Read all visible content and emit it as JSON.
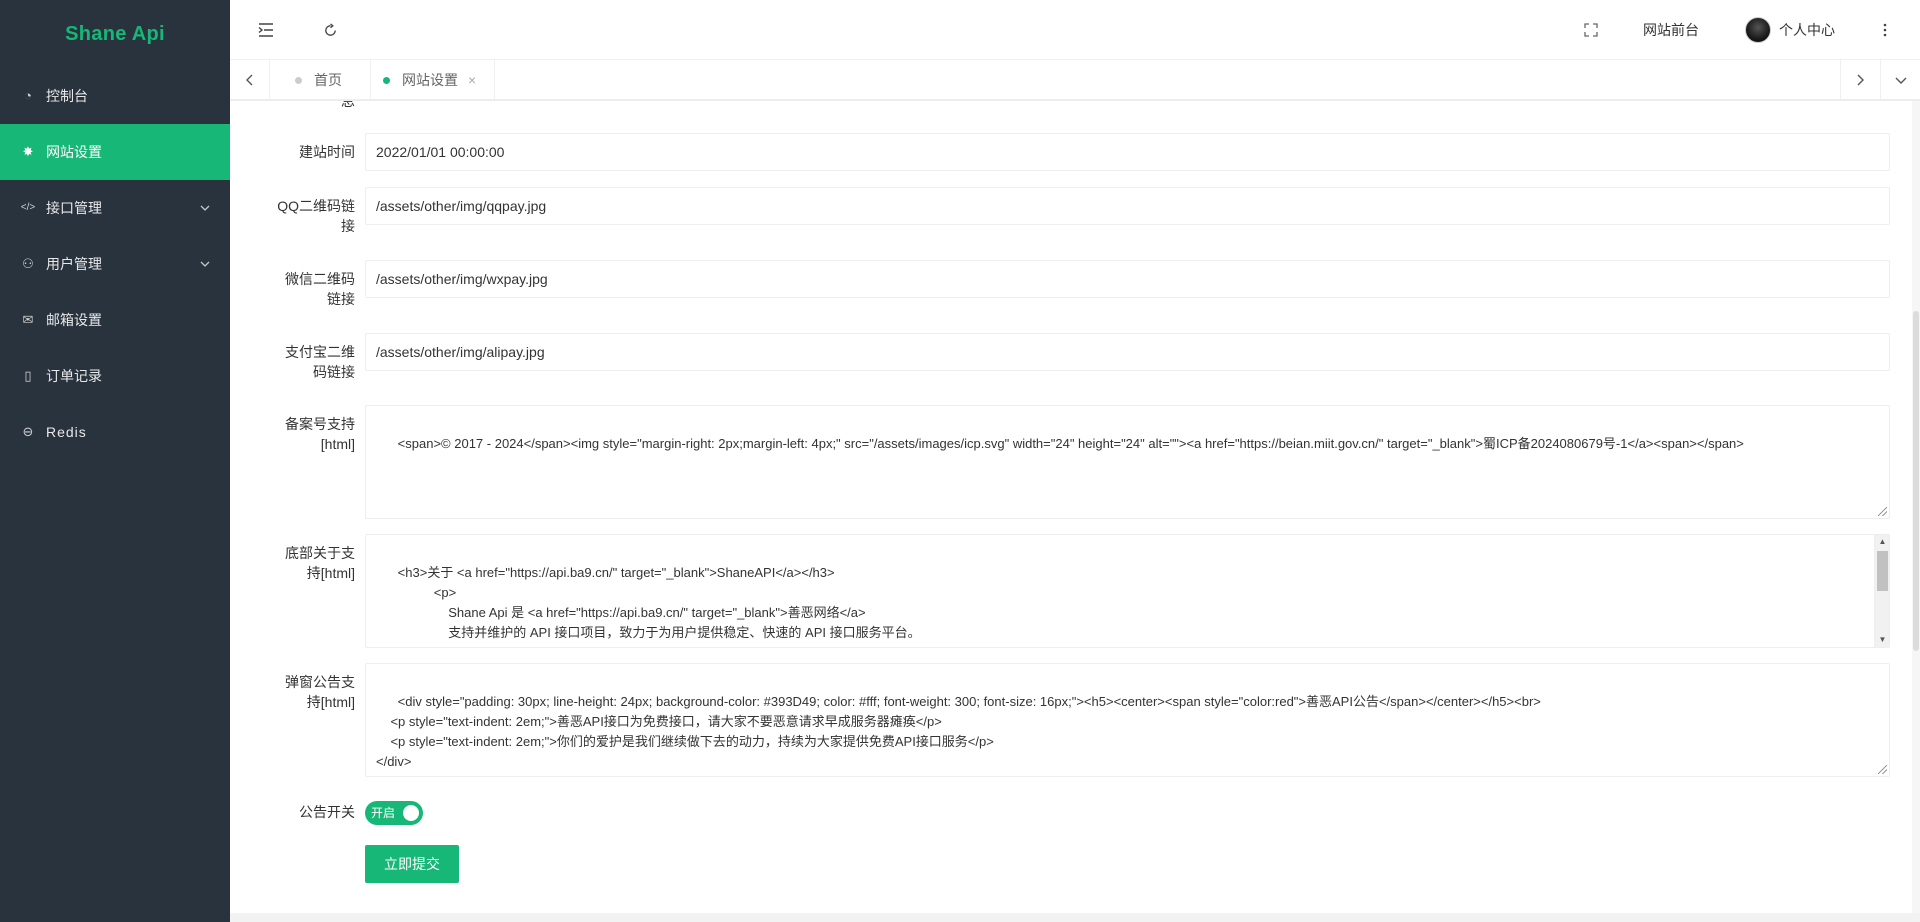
{
  "app": {
    "logo": "Shane Api"
  },
  "sidebar": {
    "items": [
      {
        "label": "控制台",
        "icon": "dashboard-icon",
        "glyph": "◔"
      },
      {
        "label": "网站设置",
        "icon": "gear-icon",
        "glyph": "✸",
        "active": true
      },
      {
        "label": "接口管理",
        "icon": "code-icon",
        "glyph": "</>",
        "expandable": true
      },
      {
        "label": "用户管理",
        "icon": "user-icon",
        "glyph": "⚇",
        "expandable": true
      },
      {
        "label": "邮箱设置",
        "icon": "mail-icon",
        "glyph": "✉"
      },
      {
        "label": "订单记录",
        "icon": "mobile-icon",
        "glyph": "▯"
      },
      {
        "label": "Redis",
        "icon": "redis-icon",
        "glyph": "⊖"
      }
    ]
  },
  "header": {
    "frontend_label": "网站前台",
    "profile_label": "个人中心"
  },
  "tabs": [
    {
      "label": "首页",
      "active": false
    },
    {
      "label": "网站设置",
      "active": true,
      "close": "×"
    }
  ],
  "form": {
    "clipped_label": "息",
    "build_time": {
      "label": "建站时间",
      "value": "2022/01/01 00:00:00"
    },
    "qq_qr": {
      "label_line1": "QQ二维码链",
      "label_line2": "接",
      "value": "/assets/other/img/qqpay.jpg"
    },
    "wx_qr": {
      "label_line1": "微信二维码",
      "label_line2": "链接",
      "value": "/assets/other/img/wxpay.jpg"
    },
    "ali_qr": {
      "label_line1": "支付宝二维",
      "label_line2": "码链接",
      "value": "/assets/other/img/alipay.jpg"
    },
    "icp": {
      "label_line1": "备案号支持",
      "label_line2": "[html]",
      "value": "<span>© 2017 - 2024</span><img style=\"margin-right: 2px;margin-left: 4px;\" src=\"/assets/images/icp.svg\" width=\"24\" height=\"24\" alt=\"\"><a href=\"https://beian.miit.gov.cn/\" target=\"_blank\">蜀ICP备2024080679号-1</a><span></span>"
    },
    "about": {
      "label_line1": "底部关于支",
      "label_line2": "持[html]",
      "value": "<h3>关于 <a href=\"https://api.ba9.cn/\" target=\"_blank\">ShaneAPI</a></h3>\n                <p>\n                    Shane Api 是 <a href=\"https://api.ba9.cn/\" target=\"_blank\">善恶网络</a>\n                    支持并维护的 API 接口项目，致力于为用户提供稳定、快速的 API 接口服务平台。\n                </p>"
    },
    "popup": {
      "label_line1": "弹窗公告支",
      "label_line2": "持[html]",
      "value": "<div style=\"padding: 30px; line-height: 24px; background-color: #393D49; color: #fff; font-weight: 300; font-size: 16px;\"><h5><center><span style=\"color:red\">善恶API公告</span></center></h5><br>\n    <p style=\"text-indent: 2em;\">善恶API接口为免费接口，请大家不要恶意请求早成服务器瘫痪</p>\n    <p style=\"text-indent: 2em;\">你们的爱护是我们继续做下去的动力，持续为大家提供免费API接口服务</p>\n</div>"
    },
    "notice_switch": {
      "label": "公告开关",
      "state_text": "开启",
      "on": true
    },
    "submit_label": "立即提交"
  },
  "colors": {
    "accent": "#16b777",
    "sidebar_bg": "#28333e"
  }
}
